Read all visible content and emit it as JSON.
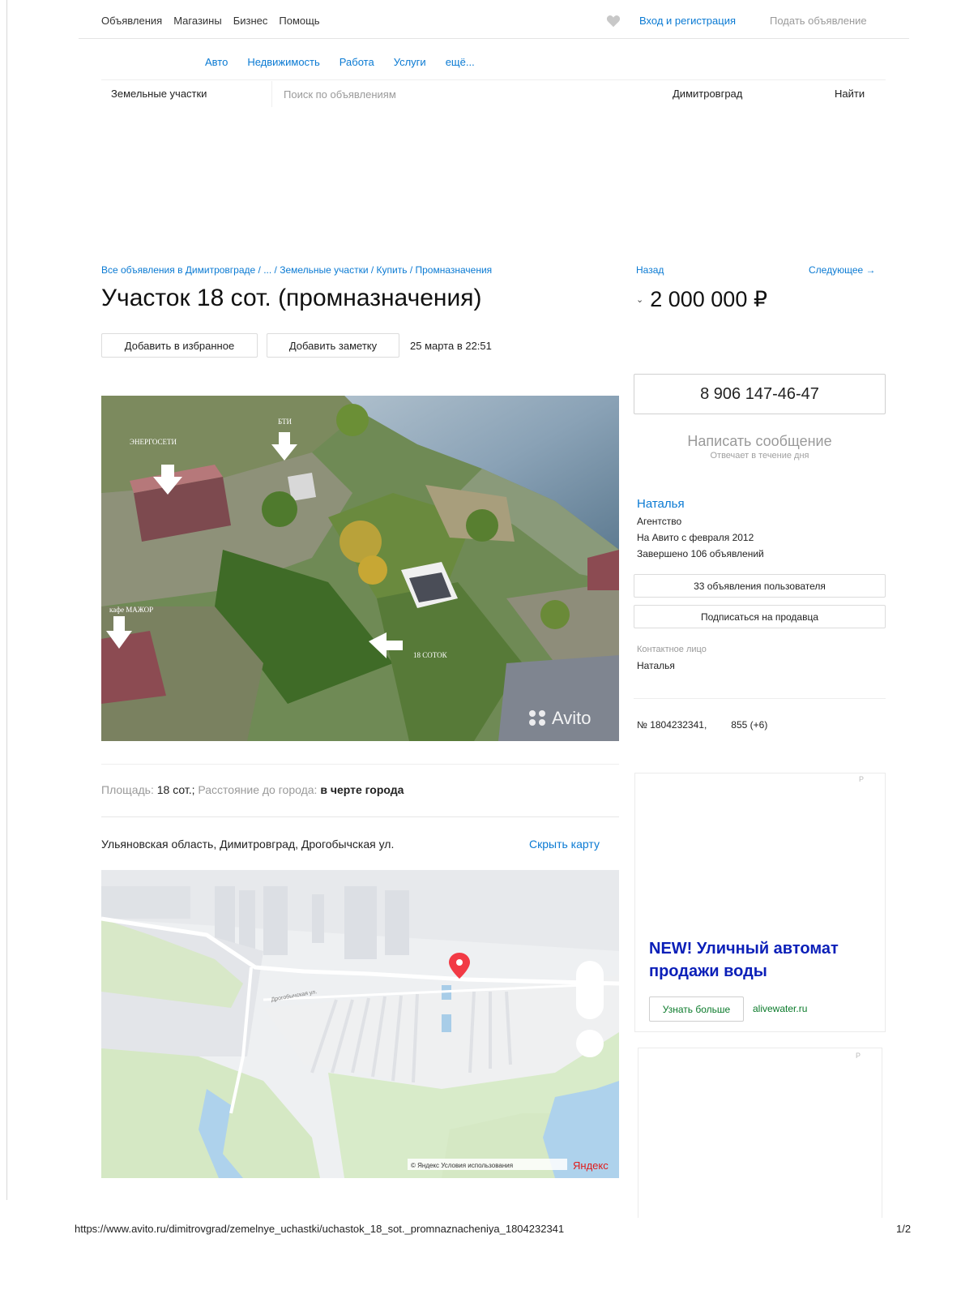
{
  "topnav": {
    "items": [
      "Объявления",
      "Магазины",
      "Бизнес",
      "Помощь"
    ],
    "login": "Вход и регистрация",
    "post_ad": "Подать объявление"
  },
  "categories": [
    "Авто",
    "Недвижимость",
    "Работа",
    "Услуги",
    "ещё..."
  ],
  "search": {
    "category": "Земельные участки",
    "placeholder": "Поиск по объявлениям",
    "city": "Димитровград",
    "button": "Найти"
  },
  "breadcrumb": "Все объявления в Димитровграде / ... / Земельные участки / Купить / Промназначения",
  "nav": {
    "back": "Назад",
    "next": "Следующее →"
  },
  "listing": {
    "title": "Участок 18 сот. (промназначения)",
    "price": "2 000 000 ₽",
    "add_favorite": "Добавить в избранное",
    "add_note": "Добавить заметку",
    "date": "25 марта в 22:51",
    "photo_watermark": "Avito",
    "photo_labels": [
      "ЭНЕРГОСЕТИ",
      "БТИ",
      "кафе МАЖОР",
      "18 СОТОК"
    ],
    "params": {
      "area_label": "Площадь:",
      "area_value": "18 сот.;",
      "distance_label": "Расстояние до города:",
      "distance_value": "в черте города"
    },
    "address": "Ульяновская область, Димитровград, Дрогобычская ул.",
    "hide_map": "Скрыть карту",
    "map_street": "Дрогобычская ул.",
    "map_attribution": "© Яндекс Условия использования",
    "map_brand": "Яндекс"
  },
  "seller": {
    "phone": "8 906 147-46-47",
    "write_message": "Написать сообщение",
    "responds": "Отвечает в течение дня",
    "name": "Наталья",
    "type": "Агентство",
    "since": "На Авито с февраля 2012",
    "completed": "Завершено 106 объявлений",
    "ads_button": "33 объявления пользователя",
    "subscribe_button": "Подписаться на продавца",
    "contact_label": "Контактное лицо",
    "contact_name": "Наталья",
    "ad_number": "№ 1804232341,",
    "views": "855 (+6)"
  },
  "ad": {
    "mark": "P",
    "title": "NEW! Уличный автомат продажи воды",
    "button": "Узнать больше",
    "domain": "alivewater.ru"
  },
  "footer": {
    "url": "https://www.avito.ru/dimitrovgrad/zemelnye_uchastki/uchastok_18_sot._promnaznacheniya_1804232341",
    "page": "1/2"
  },
  "colors": {
    "link": "#0a7ad3",
    "ad_title": "#0b1fb8",
    "ad_green": "#0a7a2a"
  }
}
